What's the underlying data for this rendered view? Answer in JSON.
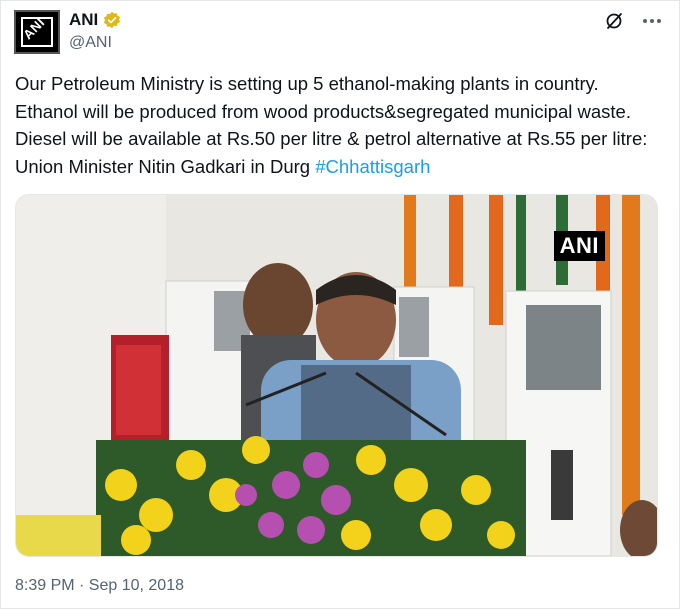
{
  "author": {
    "name": "ANI",
    "handle": "@ANI",
    "avatar_label": "ANI",
    "verified_color": "#e2b719"
  },
  "tweet": {
    "text": "Our Petroleum Ministry is setting up 5 ethanol-making plants in country. Ethanol will be produced from wood products&segregated municipal waste. Diesel will be available at Rs.50 per litre & petrol alternative at Rs.55 per litre: Union Minister Nitin Gadkari in Durg ",
    "hashtag": "#Chhattisgarh",
    "hashtag_color": "#1d9bf0",
    "media_watermark": "ANI",
    "timestamp": "8:39 PM · Sep 10, 2018"
  },
  "icons": {
    "grok": "grok-icon",
    "more": "more-icon",
    "verified": "verified-badge-icon"
  }
}
